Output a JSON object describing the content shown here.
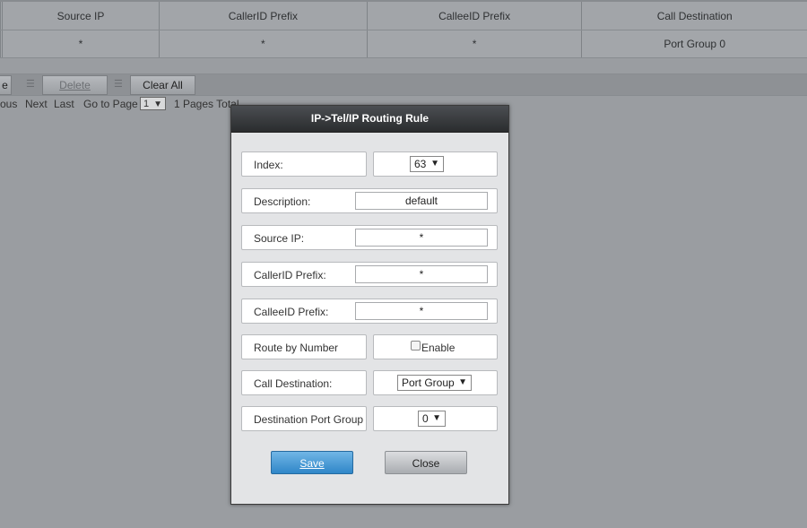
{
  "table": {
    "headers": [
      "Source IP",
      "CallerID Prefix",
      "CalleeID Prefix",
      "Call Destination"
    ],
    "rows": [
      [
        "*",
        "*",
        "*",
        "Port Group 0"
      ]
    ]
  },
  "toolbar": {
    "partial_button_label": "e",
    "delete_label": "Delete",
    "clear_all_label": "Clear All"
  },
  "pager": {
    "previous_label": "ous",
    "next_label": "Next",
    "last_label": "Last",
    "goto_label": "Go to Page",
    "page_value": "1",
    "total_label": "1 Pages Total"
  },
  "modal": {
    "title": "IP->Tel/IP Routing Rule",
    "index": {
      "label": "Index:",
      "value": "63"
    },
    "description": {
      "label": "Description:",
      "value": "default"
    },
    "source_ip": {
      "label": "Source IP:",
      "value": "*"
    },
    "callerid_prefix": {
      "label": "CallerID Prefix:",
      "value": "*"
    },
    "calleeid_prefix": {
      "label": "CalleeID Prefix:",
      "value": "*"
    },
    "route_by_number": {
      "label": "Route by Number",
      "checkbox_label": "Enable",
      "checked": false
    },
    "call_destination": {
      "label": "Call Destination:",
      "value": "Port Group"
    },
    "destination_port_group": {
      "label": "Destination Port Group",
      "value": "0"
    },
    "save_label": "Save",
    "close_label": "Close"
  },
  "icons": {
    "dropdown": "triangle-down",
    "separator": "grip-lines"
  },
  "colors": {
    "save_button": "#2f86c8",
    "title_bar": "#2a2c2e",
    "overlay": "#9a9da1"
  }
}
